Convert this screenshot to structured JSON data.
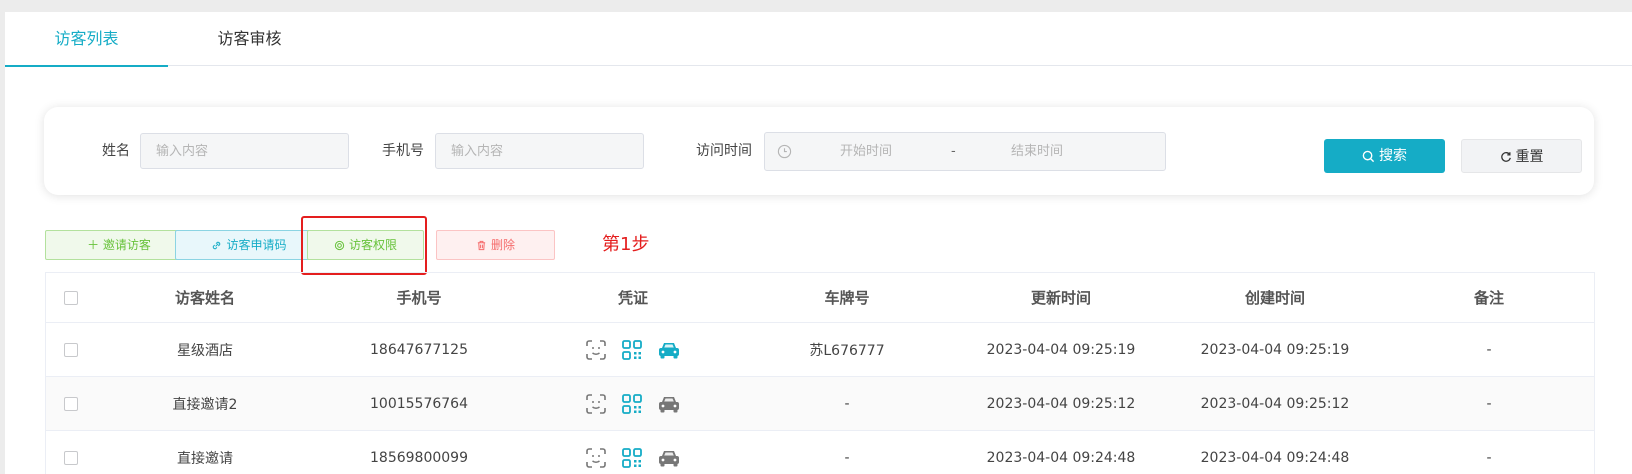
{
  "tabs": [
    {
      "label": "访客列表",
      "active": true
    },
    {
      "label": "访客审核",
      "active": false
    }
  ],
  "search": {
    "name_label": "姓名",
    "name_placeholder": "输入内容",
    "phone_label": "手机号",
    "phone_placeholder": "输入内容",
    "time_label": "访问时间",
    "start_placeholder": "开始时间",
    "range_sep": "-",
    "end_placeholder": "结束时间",
    "search_label": "搜索",
    "reset_label": "重置"
  },
  "actions": {
    "invite": "邀请访客",
    "apply_code": "访客申请码",
    "permission": "访客权限",
    "delete": "删除"
  },
  "annotation": {
    "step": "第1步"
  },
  "table": {
    "headers": [
      "访客姓名",
      "手机号",
      "凭证",
      "车牌号",
      "更新时间",
      "创建时间",
      "备注"
    ],
    "rows": [
      {
        "name": "星级酒店",
        "phone": "18647677125",
        "plate": "苏L676777",
        "updated": "2023-04-04 09:25:19",
        "created": "2023-04-04 09:25:19",
        "remark": "-",
        "car_icon_active": true
      },
      {
        "name": "直接邀请2",
        "phone": "10015576764",
        "plate": "-",
        "updated": "2023-04-04 09:25:12",
        "created": "2023-04-04 09:25:12",
        "remark": "-",
        "car_icon_active": false
      },
      {
        "name": "直接邀请",
        "phone": "18569800099",
        "plate": "-",
        "updated": "2023-04-04 09:24:48",
        "created": "2023-04-04 09:24:48",
        "remark": "-",
        "car_icon_active": false
      }
    ]
  },
  "colors": {
    "accent": "#15acc6",
    "success": "#67c23a",
    "danger": "#f56c6c",
    "annotation": "#e41e1e",
    "icon_inactive": "#777777"
  },
  "icons": {
    "credential": [
      "face-icon",
      "qrcode-icon",
      "car-icon"
    ],
    "search": "search-icon",
    "reset": "refresh-icon",
    "invite": "plus-icon",
    "apply_code": "link-icon",
    "permission": "settings-icon",
    "delete": "trash-icon",
    "date": "clock-icon"
  }
}
